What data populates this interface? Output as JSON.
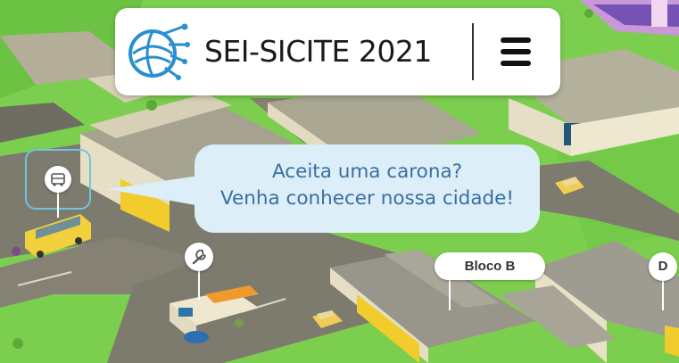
{
  "header": {
    "title": "SEI-SICITE 2021",
    "logo_icon": "circuit-globe-logo",
    "menu_icon": "hamburger-menu-icon"
  },
  "bubble": {
    "line1": "Aceita uma carona?",
    "line2": "Venha conhecer nossa cidade!"
  },
  "map_labels": {
    "bloco_b": "Bloco B",
    "d": "D"
  },
  "pins": {
    "bus_icon": "bus-icon",
    "wrench_icon": "wrench-icon"
  },
  "colors": {
    "grass": "#7ccf4e",
    "road": "#7d7a6e",
    "bubble_bg": "#dceef8",
    "bubble_text": "#3a6fa0",
    "bus_yellow": "#f2cf3c",
    "logo_blue": "#2a8fd0"
  }
}
